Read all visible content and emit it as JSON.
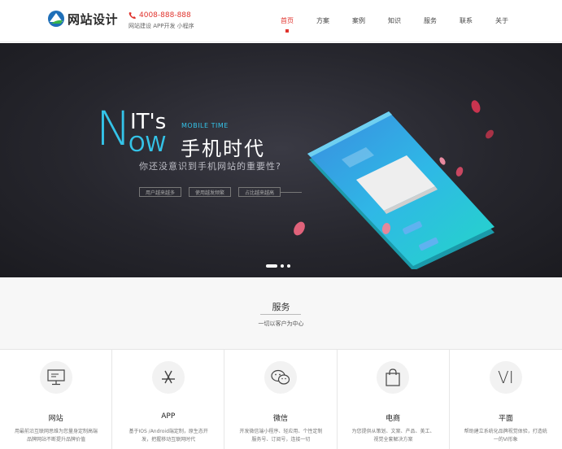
{
  "header": {
    "logo_text": "网站设计",
    "phone": "4008-888-888",
    "tagline": "网站建设 APP开发 小程序",
    "nav": [
      {
        "label": "首页",
        "active": true
      },
      {
        "label": "方案",
        "active": false
      },
      {
        "label": "案例",
        "active": false
      },
      {
        "label": "知识",
        "active": false
      },
      {
        "label": "服务",
        "active": false
      },
      {
        "label": "联系",
        "active": false
      },
      {
        "label": "关于",
        "active": false
      }
    ]
  },
  "banner": {
    "big_letter": "N",
    "its": "IT's",
    "ow": "OW",
    "mobile_time": "MOBILE TIME",
    "cn_title": "手机时代",
    "cn_subtitle": "你还没意识到手机网站的重要性?",
    "pills": [
      "用户越来越多",
      "使用越发频繁",
      "占比越来越高"
    ],
    "slides": 3
  },
  "services": {
    "title": "服务",
    "subtitle": "一切以客户为中心",
    "cards": [
      {
        "title": "网站",
        "icon": "monitor-icon",
        "desc": "用最前沿互联网思维为您量身定制高端品牌网站不断提升品牌价值"
      },
      {
        "title": "APP",
        "icon": "app-store-icon",
        "desc": "基于IOS /Android端定制，原生态开发，把握移动互联网时代"
      },
      {
        "title": "微信",
        "icon": "wechat-icon",
        "desc": "开发微信端小程序、轻应用、个性定制服务号、订阅号，连接一切"
      },
      {
        "title": "电商",
        "icon": "shopping-bag-icon",
        "desc": "为您提供从策划、文案、产品、美工、视觉全套解决方案"
      },
      {
        "title": "平面",
        "icon": "vi-icon",
        "icon_text": "VI",
        "desc": "帮助建立系统化品牌视觉体验，打造统一的VI形象"
      }
    ]
  },
  "colors": {
    "accent": "#e0332d",
    "banner_blue": "#34c3e8"
  }
}
